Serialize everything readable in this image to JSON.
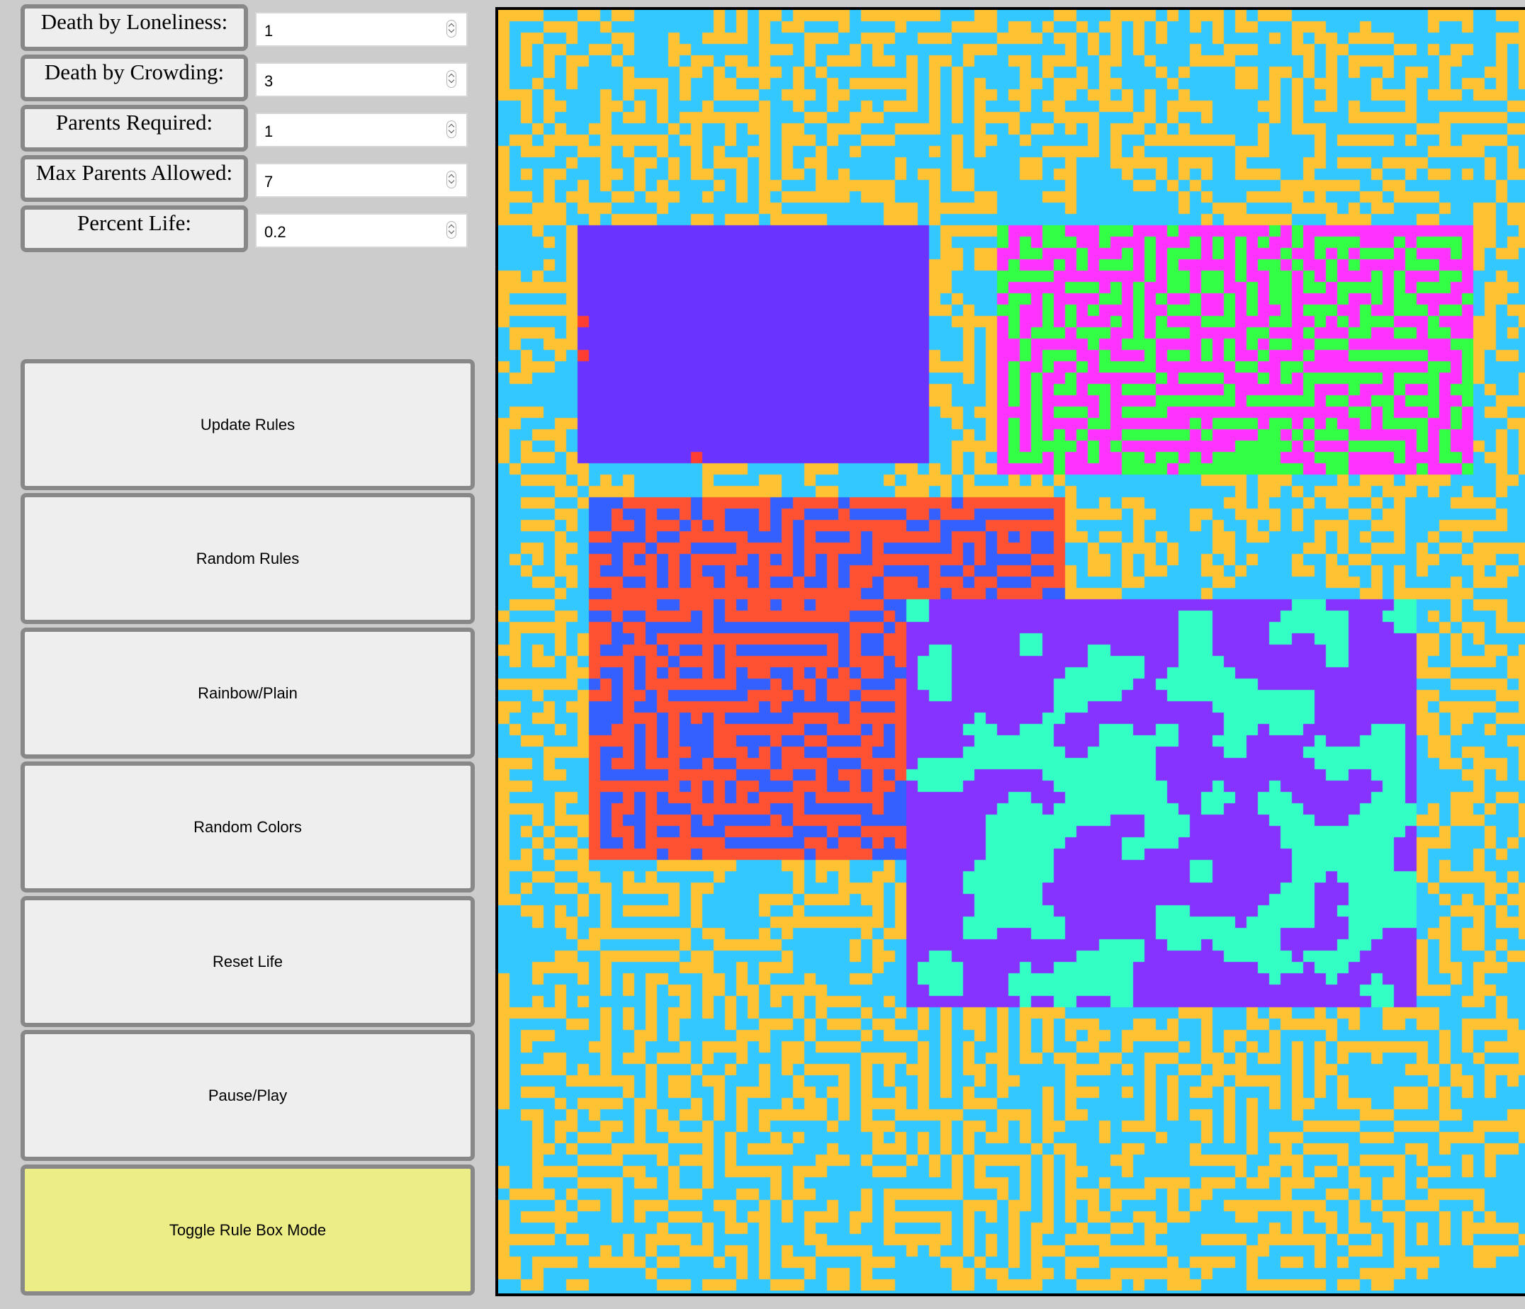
{
  "rules": [
    {
      "label": "Death by Loneliness:",
      "value": "1"
    },
    {
      "label": "Death by Crowding:",
      "value": "3"
    },
    {
      "label": "Parents Required:",
      "value": "1"
    },
    {
      "label": "Max Parents Allowed:",
      "value": "7"
    },
    {
      "label": "Percent Life:",
      "value": "0.2"
    }
  ],
  "buttons": [
    {
      "label": "Update Rules"
    },
    {
      "label": "Random Rules"
    },
    {
      "label": "Rainbow/Plain"
    },
    {
      "label": "Random Colors"
    },
    {
      "label": "Reset Life"
    },
    {
      "label": "Pause/Play"
    },
    {
      "label": "Toggle Rule Box Mode",
      "active": true
    }
  ],
  "colors": {
    "page_background": "#cccccc",
    "label_border": "#888888",
    "button_face": "#eeeeee",
    "toggle_active": "#eded88"
  },
  "life_grid": {
    "visible_columns": 91,
    "visible_rows": 113,
    "background": {
      "dead": "#33c8ff",
      "alive": "#ffc233",
      "density": 0.36,
      "style": "tangled"
    },
    "rule_boxes": [
      {
        "name": "rule-box-1",
        "cols": [
          7,
          37
        ],
        "rows": [
          19,
          39
        ],
        "dead": "#6a33ff",
        "alive": "#ff3e33",
        "density": 0.03,
        "style": "sparse-edge"
      },
      {
        "name": "rule-box-2",
        "cols": [
          44,
          85
        ],
        "rows": [
          19,
          40
        ],
        "dead": "#33ff44",
        "alive": "#ff33ff",
        "density": 0.45,
        "style": "maze"
      },
      {
        "name": "rule-box-3",
        "cols": [
          8,
          49
        ],
        "rows": [
          43,
          51
        ],
        "dead": "#3460ff",
        "alive": "#ff5233",
        "density": 0.5,
        "style": "maze"
      },
      {
        "name": "rule-box-3b",
        "cols": [
          8,
          35
        ],
        "rows": [
          52,
          74
        ],
        "dead": "#3460ff",
        "alive": "#ff5233",
        "density": 0.5,
        "style": "maze"
      },
      {
        "name": "rule-box-4",
        "cols": [
          36,
          80
        ],
        "rows": [
          52,
          87
        ],
        "dead": "#8733ff",
        "alive": "#33ffc4",
        "density": 0.4,
        "style": "blobs"
      }
    ]
  }
}
